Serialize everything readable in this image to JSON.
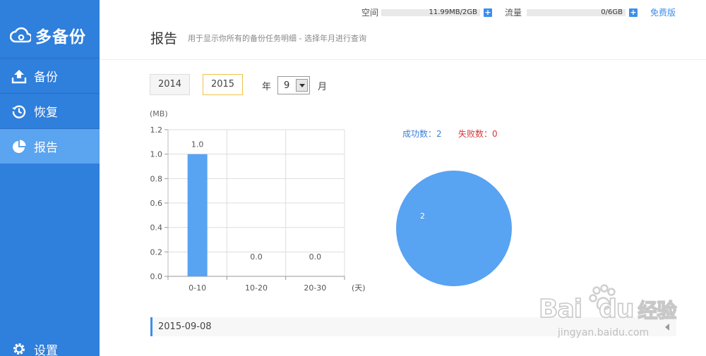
{
  "app": {
    "logo_text": "多备份"
  },
  "sidebar": {
    "items": [
      {
        "label": "备份",
        "icon": "upload-icon"
      },
      {
        "label": "恢复",
        "icon": "history-icon"
      },
      {
        "label": "报告",
        "icon": "pie-chart-icon",
        "active": true
      }
    ],
    "settings_label": "设置"
  },
  "header": {
    "space_label": "空间",
    "space_value": "11.99MB/2GB",
    "traffic_label": "流量",
    "traffic_value": "0/6GB",
    "plan_link": "免费版",
    "title": "报告",
    "subtitle": "用于显示你所有的备份任务明细 - 选择年月进行查询"
  },
  "filters": {
    "years": [
      "2014",
      "2015"
    ],
    "selected_year": "2015",
    "year_suffix": "年",
    "month_value": "9",
    "month_suffix": "月"
  },
  "chart_data": [
    {
      "type": "bar",
      "ylabel": "(MB)",
      "xlabel": "(天)",
      "categories": [
        "0-10",
        "10-20",
        "20-30"
      ],
      "values": [
        1.0,
        0.0,
        0.0
      ],
      "data_labels": [
        "1.0",
        "0.0",
        "0.0"
      ],
      "ylim": [
        0,
        1.2
      ],
      "yticks": [
        "0.0",
        "0.2",
        "0.4",
        "0.6",
        "0.8",
        "1.0",
        "1.2"
      ],
      "grid": true,
      "color": "#58a3f2"
    },
    {
      "type": "pie",
      "slices": [
        {
          "name": "成功数",
          "value": 2,
          "label": "2",
          "color": "#58a3f2"
        }
      ],
      "legend": [
        {
          "text": "成功数：2",
          "color": "#3d7fd8"
        },
        {
          "text": "失败数：0",
          "color": "#d33a3a"
        }
      ]
    }
  ],
  "records": [
    {
      "date": "2015-09-08"
    }
  ],
  "watermark": {
    "text1": "Bai",
    "text2": "du",
    "text3": "经验",
    "url": "jingyan.baidu.com"
  }
}
